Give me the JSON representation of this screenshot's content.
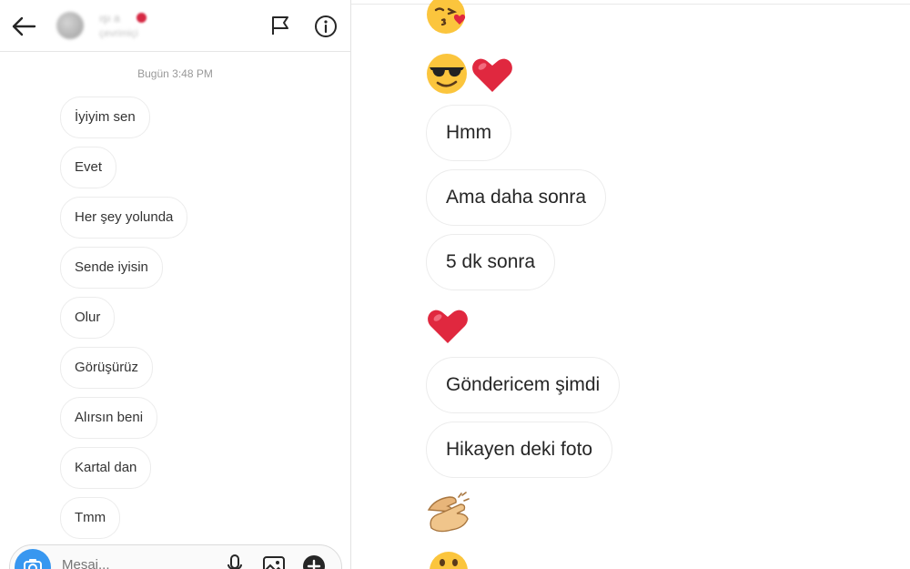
{
  "header": {
    "contact_name": "ışı a",
    "contact_status": "çevrimiçi",
    "back_icon": "arrow-left-icon",
    "flag_icon": "flag-icon",
    "info_icon": "info-icon"
  },
  "chat": {
    "timestamp": "Bugün 3:48 PM",
    "messages": [
      "İyiyim sen",
      "Evet",
      "Her şey yolunda",
      "Sende iyisin",
      "Olur",
      "Görüşürüz",
      "Alırsın beni",
      "Kartal dan",
      "Tmm"
    ]
  },
  "composer": {
    "placeholder": "Mesaj...",
    "camera_icon": "camera-icon",
    "mic_icon": "microphone-icon",
    "gallery_icon": "gallery-icon",
    "plus_icon": "plus-icon"
  },
  "right_chat": {
    "messages": [
      "Hmm",
      "Ama daha sonra",
      "5 dk sonra",
      "Göndericem şimdi",
      "Hikayen deki foto"
    ],
    "emojis": {
      "kiss": "kissing-face-emoji",
      "sunglasses": "smiling-face-with-sunglasses-emoji",
      "heart": "red-heart-emoji",
      "clap": "clapping-hands-emoji",
      "partial": "smiling-face-emoji"
    }
  },
  "colors": {
    "accent": "#3897f0",
    "heart": "#e0283f",
    "emoji_face": "#fbc53d"
  }
}
